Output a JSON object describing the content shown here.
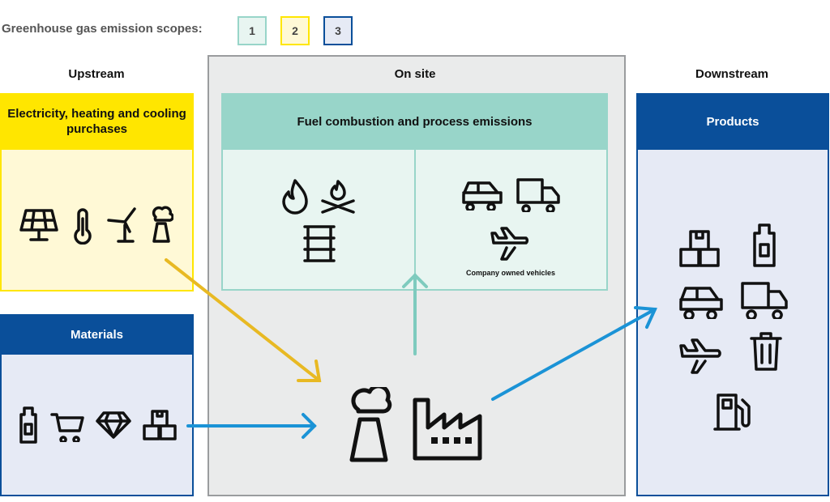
{
  "legend": {
    "label": "Greenhouse gas emission scopes:",
    "scopes": [
      {
        "label": "1",
        "color": "#98D5C9",
        "fill": "#E8F5F1"
      },
      {
        "label": "2",
        "color": "#FFE600",
        "fill": "#FFF9D6"
      },
      {
        "label": "3",
        "color": "#0A4F9A",
        "fill": "#E6EAF5"
      }
    ]
  },
  "upstream": {
    "heading": "Upstream",
    "energy": {
      "title": "Electricity, heating and cooling purchases",
      "icons": [
        "solar-panel-icon",
        "thermometer-icon",
        "wind-turbine-icon",
        "chimney-icon"
      ]
    },
    "materials": {
      "title": "Materials",
      "icons": [
        "bottle-icon",
        "cart-icon",
        "diamond-icon",
        "boxes-icon"
      ]
    }
  },
  "onsite": {
    "heading": "On site",
    "fuel": {
      "title": "Fuel combustion and process emissions",
      "left_icons": [
        "flame-icon",
        "campfire-icon",
        "barrel-icon"
      ],
      "right_icons": [
        "car-icon",
        "truck-icon",
        "airplane-icon"
      ],
      "vehicles_caption": "Company owned vehicles"
    },
    "facility_icons": [
      "chimney-icon",
      "factory-icon"
    ]
  },
  "downstream": {
    "heading": "Downstream",
    "products": {
      "title": "Products",
      "icons": [
        "boxes-icon",
        "bottle-icon",
        "car-icon",
        "truck-icon",
        "airplane-icon",
        "trash-icon",
        "fuel-pump-icon"
      ]
    }
  },
  "colors": {
    "yellow_arrow": "#E8B923",
    "blue_arrow": "#1B93D6",
    "teal_arrow": "#7ECBBE",
    "onsite_bg": "#EAEBEB"
  }
}
